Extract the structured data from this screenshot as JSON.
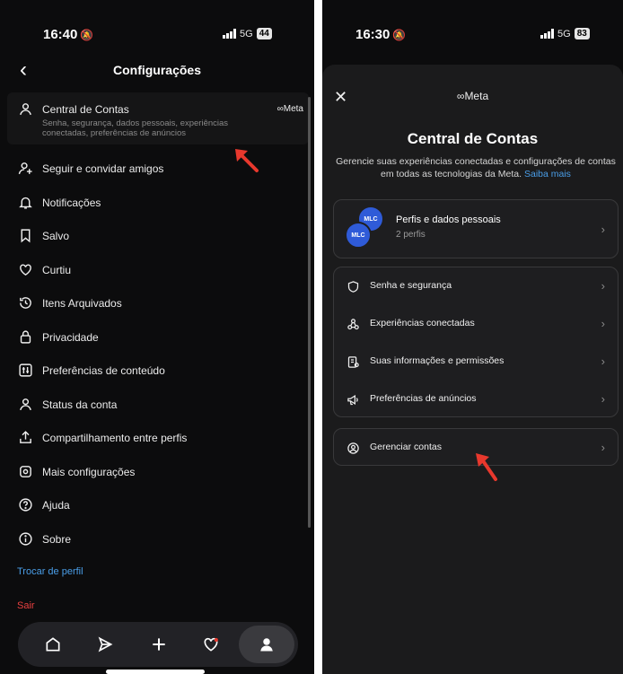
{
  "left": {
    "status": {
      "time": "16:40",
      "network": "5G",
      "battery": "44"
    },
    "header": {
      "title": "Configurações",
      "back_icon": "chevron-left-icon"
    },
    "account_center": {
      "label": "Central de Contas",
      "subtitle": "Senha, segurança, dados pessoais, experiências conectadas, preferências de anúncios",
      "meta_tag": "Meta",
      "icon": "person-icon"
    },
    "items": [
      {
        "label": "Seguir e convidar amigos",
        "icon": "add-person-icon"
      },
      {
        "label": "Notificações",
        "icon": "bell-icon"
      },
      {
        "label": "Salvo",
        "icon": "bookmark-icon"
      },
      {
        "label": "Curtiu",
        "icon": "heart-icon"
      },
      {
        "label": "Itens Arquivados",
        "icon": "archive-clock-icon"
      },
      {
        "label": "Privacidade",
        "icon": "lock-icon"
      },
      {
        "label": "Preferências de conteúdo",
        "icon": "content-prefs-icon"
      },
      {
        "label": "Status da conta",
        "icon": "person-icon"
      },
      {
        "label": "Compartilhamento entre perfis",
        "icon": "share-icon"
      },
      {
        "label": "Mais configurações",
        "icon": "gear-icon"
      },
      {
        "label": "Ajuda",
        "icon": "help-icon"
      },
      {
        "label": "Sobre",
        "icon": "info-icon"
      }
    ],
    "switch_profile": "Trocar de perfil",
    "logout": "Sair",
    "tabbar": {
      "icons": [
        "home-icon",
        "send-icon",
        "plus-icon",
        "heart-icon",
        "profile-icon"
      ],
      "active": "profile-icon"
    }
  },
  "right": {
    "status": {
      "time": "16:30",
      "network": "5G",
      "battery": "83"
    },
    "close_icon": "close-icon",
    "meta_logo": "Meta",
    "title": "Central de Contas",
    "description": "Gerencie suas experiências conectadas e configurações de contas em todas as tecnologias da Meta.",
    "learn_more": "Saiba mais",
    "profiles": {
      "title": "Perfis e dados pessoais",
      "subtitle": "2 perfis",
      "avatar_text": "MLC"
    },
    "settings": [
      {
        "label": "Senha e segurança",
        "icon": "shield-icon"
      },
      {
        "label": "Experiências conectadas",
        "icon": "connected-icon"
      },
      {
        "label": "Suas informações e permissões",
        "icon": "document-icon"
      },
      {
        "label": "Preferências de anúncios",
        "icon": "megaphone-icon"
      }
    ],
    "manage_accounts": {
      "label": "Gerenciar contas",
      "icon": "account-circle-icon"
    }
  },
  "colors": {
    "background": "#0c0c0d",
    "sheet": "#1b1b1c",
    "link": "#4a9ee8",
    "danger": "#e84040",
    "annotation_arrow": "#e8382d"
  }
}
